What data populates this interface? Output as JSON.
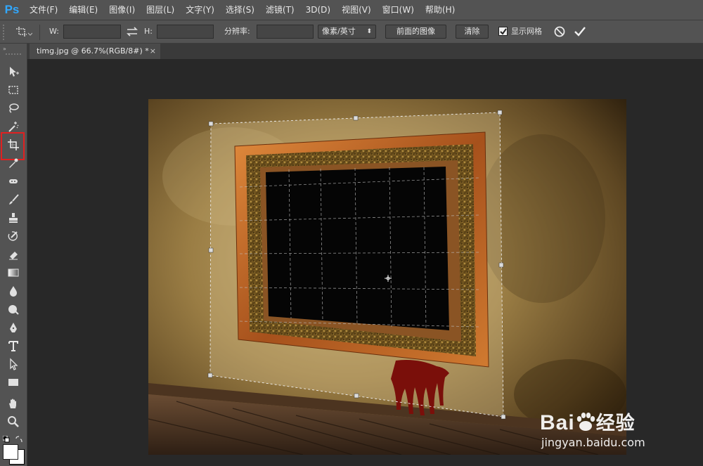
{
  "app": {
    "logo": "Ps",
    "accent": "#31a8ff"
  },
  "menu": [
    "文件(F)",
    "编辑(E)",
    "图像(I)",
    "图层(L)",
    "文字(Y)",
    "选择(S)",
    "滤镜(T)",
    "3D(D)",
    "视图(V)",
    "窗口(W)",
    "帮助(H)"
  ],
  "options": {
    "tool_icon": "crop-tool-icon",
    "w_label": "W:",
    "w_value": "",
    "swap_icon": "swap-arrows-icon",
    "h_label": "H:",
    "h_value": "",
    "resolution_label": "分辨率:",
    "resolution_value": "",
    "unit_select": "像素/英寸",
    "front_image_button": "前面的图像",
    "clear_button": "清除",
    "show_grid_label": "显示网格",
    "show_grid_checked": true,
    "cancel_icon": "cancel-circle-icon",
    "commit_icon": "checkmark-icon"
  },
  "document": {
    "tab_title": "timg.jpg @ 66.7%(RGB/8#) *",
    "close": "×"
  },
  "tools": [
    "move-tool-icon",
    "marquee-tool-icon",
    "lasso-tool-icon",
    "magic-wand-tool-icon",
    "perspective-crop-tool-icon",
    "eyedropper-tool-icon",
    "healing-brush-tool-icon",
    "brush-tool-icon",
    "clone-stamp-tool-icon",
    "history-brush-tool-icon",
    "eraser-tool-icon",
    "gradient-tool-icon",
    "blur-tool-icon",
    "dodge-tool-icon",
    "pen-tool-icon",
    "type-tool-icon",
    "path-selection-tool-icon",
    "rectangle-tool-icon",
    "hand-tool-icon",
    "zoom-tool-icon"
  ],
  "watermark": {
    "brand_latin": "Bai",
    "brand_cn": "经验",
    "url": "jingyan.baidu.com"
  }
}
